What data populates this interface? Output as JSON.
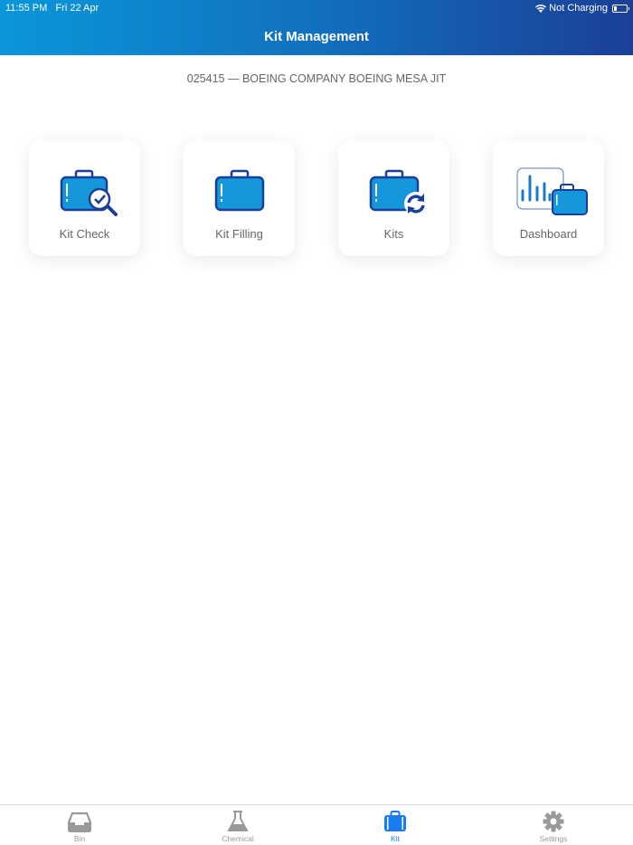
{
  "status_bar": {
    "time": "11:55 PM",
    "date": "Fri 22 Apr",
    "charging": "Not Charging"
  },
  "header": {
    "title": "Kit Management"
  },
  "account": "025415 — BOEING COMPANY BOEING MESA JIT",
  "cards": [
    {
      "label": "Kit Check",
      "icon": "kit-check-icon"
    },
    {
      "label": "Kit Filling",
      "icon": "suitcase-icon"
    },
    {
      "label": "Kits",
      "icon": "kits-refresh-icon"
    },
    {
      "label": "Dashboard",
      "icon": "dashboard-chart-icon"
    }
  ],
  "tabs": [
    {
      "label": "Bin",
      "icon": "tray-icon"
    },
    {
      "label": "Chemical",
      "icon": "flask-icon"
    },
    {
      "label": "Kit",
      "icon": "suitcase-icon",
      "active": true
    },
    {
      "label": "Settings",
      "icon": "gear-icon"
    }
  ],
  "colors": {
    "accent": "#1a7cf2",
    "suitcase": "#1597db",
    "outline": "#1a3f9a"
  }
}
